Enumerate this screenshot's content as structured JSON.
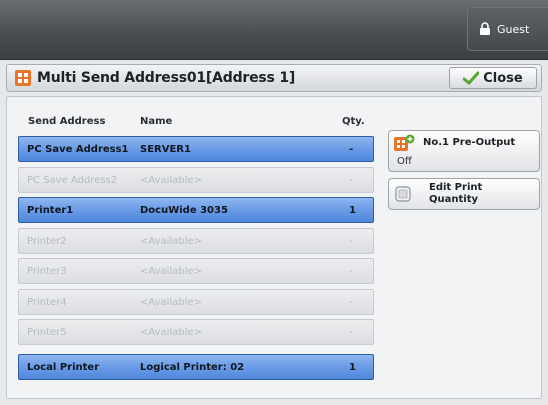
{
  "topbar": {
    "user_label": "Guest"
  },
  "window": {
    "title": "Multi Send Address01[Address 1]",
    "close_label": "Close"
  },
  "table": {
    "headers": {
      "address": "Send Address",
      "name": "Name",
      "qty": "Qty."
    },
    "rows": [
      {
        "address": "PC Save Address1",
        "name": "SERVER1",
        "qty": "-",
        "state": "active"
      },
      {
        "address": "PC Save Address2",
        "name": "<Available>",
        "qty": "-",
        "state": "inactive"
      },
      {
        "address": "Printer1",
        "name": "DocuWide 3035",
        "qty": "1",
        "state": "active"
      },
      {
        "address": "Printer2",
        "name": "<Available>",
        "qty": "-",
        "state": "inactive"
      },
      {
        "address": "Printer3",
        "name": "<Available>",
        "qty": "-",
        "state": "inactive"
      },
      {
        "address": "Printer4",
        "name": "<Available>",
        "qty": "-",
        "state": "inactive"
      },
      {
        "address": "Printer5",
        "name": "<Available>",
        "qty": "-",
        "state": "inactive"
      },
      {
        "address": "Local Printer",
        "name": "Logical Printer: 02",
        "qty": "1",
        "state": "active"
      }
    ]
  },
  "side": {
    "preoutput_label": "No.1 Pre-Output",
    "preoutput_value": "Off",
    "editqty_label": "Edit Print Quantity"
  },
  "colors": {
    "active_row": "#6a9be6",
    "inactive_row": "#dcdee1",
    "accent_orange": "#e8742a"
  }
}
